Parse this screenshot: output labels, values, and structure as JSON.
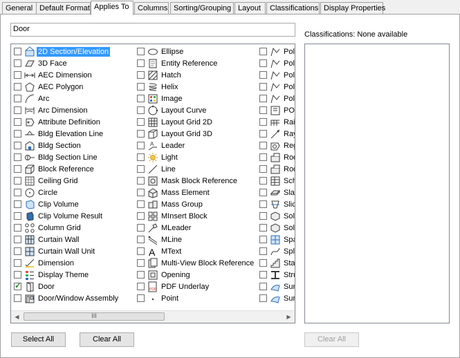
{
  "tabs": [
    "General",
    "Default Format",
    "Applies To",
    "Columns",
    "Sorting/Grouping",
    "Layout",
    "Classifications",
    "Display Properties"
  ],
  "search": {
    "value": "Door"
  },
  "columns": [
    [
      {
        "label": "2D Section/Elevation",
        "icon": "section-elevation-icon",
        "checked": false,
        "selected": true
      },
      {
        "label": "3D Face",
        "icon": "face-icon",
        "checked": false
      },
      {
        "label": "AEC Dimension",
        "icon": "dimension-icon",
        "checked": false
      },
      {
        "label": "AEC Polygon",
        "icon": "polygon-icon",
        "checked": false
      },
      {
        "label": "Arc",
        "icon": "arc-icon",
        "checked": false
      },
      {
        "label": "Arc Dimension",
        "icon": "arc-dimension-icon",
        "checked": false
      },
      {
        "label": "Attribute Definition",
        "icon": "attribute-icon",
        "checked": false
      },
      {
        "label": "Bldg Elevation Line",
        "icon": "elevation-line-icon",
        "checked": false
      },
      {
        "label": "Bldg Section",
        "icon": "bldg-section-icon",
        "checked": false
      },
      {
        "label": "Bldg Section Line",
        "icon": "section-line-icon",
        "checked": false
      },
      {
        "label": "Block Reference",
        "icon": "block-icon",
        "checked": false
      },
      {
        "label": "Ceiling Grid",
        "icon": "ceiling-grid-icon",
        "checked": false
      },
      {
        "label": "Circle",
        "icon": "circle-icon",
        "checked": false
      },
      {
        "label": "Clip Volume",
        "icon": "clip-volume-icon",
        "checked": false
      },
      {
        "label": "Clip Volume Result",
        "icon": "clip-result-icon",
        "checked": false
      },
      {
        "label": "Column Grid",
        "icon": "column-grid-icon",
        "checked": false
      },
      {
        "label": "Curtain Wall",
        "icon": "curtain-wall-icon",
        "checked": false
      },
      {
        "label": "Curtain Wall Unit",
        "icon": "curtain-unit-icon",
        "checked": false
      },
      {
        "label": "Dimension",
        "icon": "dimension2-icon",
        "checked": false
      },
      {
        "label": "Display Theme",
        "icon": "theme-icon",
        "checked": false
      },
      {
        "label": "Door",
        "icon": "door-icon",
        "checked": true
      },
      {
        "label": "Door/Window Assembly",
        "icon": "assembly-icon",
        "checked": false
      }
    ],
    [
      {
        "label": "Ellipse",
        "icon": "ellipse-icon",
        "checked": false
      },
      {
        "label": "Entity Reference",
        "icon": "entity-ref-icon",
        "checked": false
      },
      {
        "label": "Hatch",
        "icon": "hatch-icon",
        "checked": false
      },
      {
        "label": "Helix",
        "icon": "helix-icon",
        "checked": false
      },
      {
        "label": "Image",
        "icon": "image-icon",
        "checked": false
      },
      {
        "label": "Layout Curve",
        "icon": "layout-curve-icon",
        "checked": false
      },
      {
        "label": "Layout Grid 2D",
        "icon": "grid2d-icon",
        "checked": false
      },
      {
        "label": "Layout Grid 3D",
        "icon": "grid3d-icon",
        "checked": false
      },
      {
        "label": "Leader",
        "icon": "leader-icon",
        "checked": false
      },
      {
        "label": "Light",
        "icon": "light-icon",
        "checked": false
      },
      {
        "label": "Line",
        "icon": "line-icon",
        "checked": false
      },
      {
        "label": "Mask Block Reference",
        "icon": "mask-block-icon",
        "checked": false
      },
      {
        "label": "Mass Element",
        "icon": "mass-element-icon",
        "checked": false
      },
      {
        "label": "Mass Group",
        "icon": "mass-group-icon",
        "checked": false
      },
      {
        "label": "MInsert Block",
        "icon": "minsert-icon",
        "checked": false
      },
      {
        "label": "MLeader",
        "icon": "mleader-icon",
        "checked": false
      },
      {
        "label": "MLine",
        "icon": "mline-icon",
        "checked": false
      },
      {
        "label": "MText",
        "icon": "mtext-icon",
        "checked": false
      },
      {
        "label": "Multi-View Block Reference",
        "icon": "multiview-icon",
        "checked": false
      },
      {
        "label": "Opening",
        "icon": "opening-icon",
        "checked": false
      },
      {
        "label": "PDF Underlay",
        "icon": "pdf-icon",
        "checked": false
      },
      {
        "label": "Point",
        "icon": "point-icon",
        "checked": false
      }
    ],
    [
      {
        "label": "Poly",
        "icon": "poly-icon",
        "checked": false
      },
      {
        "label": "Poly",
        "icon": "poly-icon",
        "checked": false
      },
      {
        "label": "Poly",
        "icon": "poly-icon",
        "checked": false
      },
      {
        "label": "Poly",
        "icon": "poly-icon",
        "checked": false
      },
      {
        "label": "Poly",
        "icon": "poly-icon",
        "checked": false
      },
      {
        "label": "POS",
        "icon": "pos-icon",
        "checked": false
      },
      {
        "label": "Rail",
        "icon": "rail-icon",
        "checked": false
      },
      {
        "label": "Ray",
        "icon": "ray-icon",
        "checked": false
      },
      {
        "label": "Reg",
        "icon": "region-icon",
        "checked": false
      },
      {
        "label": "Roo",
        "icon": "roof-icon",
        "checked": false
      },
      {
        "label": "Roo",
        "icon": "roof-icon",
        "checked": false
      },
      {
        "label": "Sch",
        "icon": "schedule-icon",
        "checked": false
      },
      {
        "label": "Slab",
        "icon": "slab-icon",
        "checked": false
      },
      {
        "label": "Slic",
        "icon": "slice-icon",
        "checked": false
      },
      {
        "label": "Soli",
        "icon": "solid-icon",
        "checked": false
      },
      {
        "label": "Soli",
        "icon": "solid-icon",
        "checked": false
      },
      {
        "label": "Spa",
        "icon": "space-icon",
        "checked": false
      },
      {
        "label": "Spli",
        "icon": "spline-icon",
        "checked": false
      },
      {
        "label": "Stai",
        "icon": "stair-icon",
        "checked": false
      },
      {
        "label": "Stru",
        "icon": "structure-icon",
        "checked": false
      },
      {
        "label": "Surf",
        "icon": "surface-icon",
        "checked": false
      },
      {
        "label": "Surf",
        "icon": "surface-icon",
        "checked": false
      }
    ]
  ],
  "scroll_thumb_glyph": "III",
  "buttons": {
    "select_all": "Select All",
    "clear_all": "Clear All",
    "clear_all_classifications": "Clear All"
  },
  "classifications": {
    "label": "Classifications: None available"
  }
}
